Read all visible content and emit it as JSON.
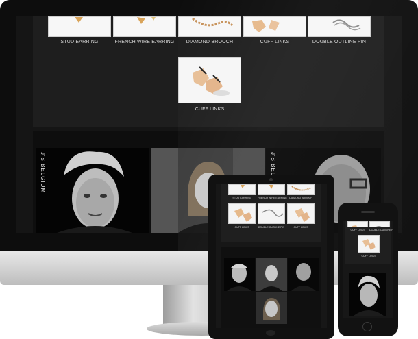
{
  "desktop": {
    "product_row": [
      {
        "caption": "STUD EARRING",
        "icon": "stud-earring-photo"
      },
      {
        "caption": "FRENCH WIRE EARRING",
        "icon": "french-wire-earring-photo"
      },
      {
        "caption": "DIAMOND BROOCH",
        "icon": "diamond-brooch-photo"
      },
      {
        "caption": "CUFF LINKS",
        "icon": "cuff-links-photo"
      },
      {
        "caption": "DOUBLE OUTLINE PIN",
        "icon": "double-outline-pin-photo"
      }
    ],
    "featured": {
      "caption": "CUFF LINKS",
      "icon": "cuff-links-photo"
    },
    "portrait_labels": [
      "J'S BELGIUM",
      "J'S BELGIUM"
    ]
  },
  "tablet": {
    "row1": [
      "STUD EARRING",
      "FRENCH WIRE EARRING",
      "DIAMOND BROOCH"
    ],
    "row2": [
      "CUFF LINKS",
      "DOUBLE OUTLINE PIN",
      "CUFF LINKS"
    ]
  },
  "phone": {
    "row1": [
      "CUFF LINKS",
      "DOUBLE OUTLINE PIN"
    ],
    "featured": "CUFF LINKS"
  },
  "colors": {
    "bezel": "#0d0d0d",
    "screen": "#151515",
    "panel": "#1e1e1e",
    "caption": "#d8d8d8",
    "accent_gold": "#d9a45a"
  }
}
